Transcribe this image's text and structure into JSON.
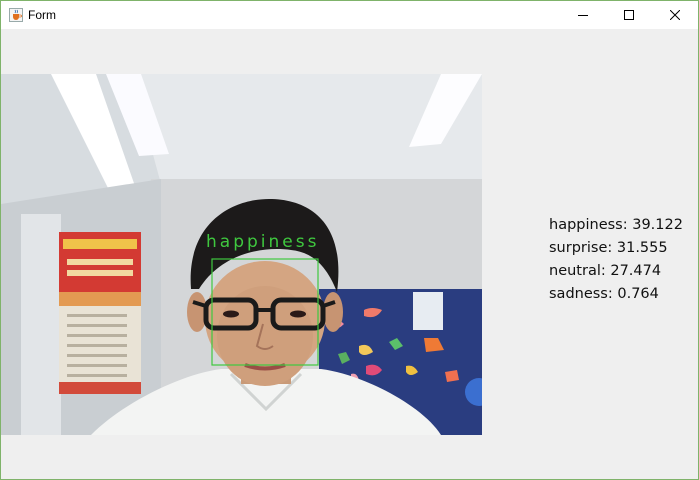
{
  "window": {
    "title": "Form",
    "icon": "java-cup-icon"
  },
  "controls": {
    "minimize_icon": "minimize-icon",
    "maximize_icon": "maximize-icon",
    "close_icon": "close-icon"
  },
  "camera": {
    "detected_label": "happiness",
    "box_color": "#3fc83f"
  },
  "results": [
    {
      "emotion": "happiness",
      "score": "39.122",
      "text": "happiness: 39.122"
    },
    {
      "emotion": "surprise",
      "score": "31.555",
      "text": "surprise: 31.555"
    },
    {
      "emotion": "neutral",
      "score": "27.474",
      "text": "neutral: 27.474"
    },
    {
      "emotion": "sadness",
      "score": "0.764",
      "text": "sadness: 0.764"
    }
  ]
}
